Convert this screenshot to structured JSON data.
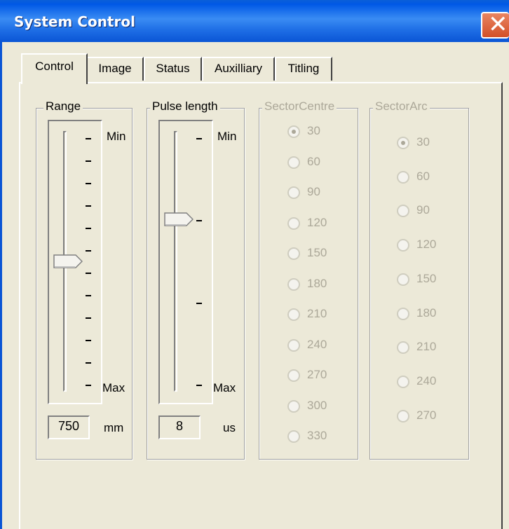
{
  "window": {
    "title": "System Control",
    "close_symbol": "✕"
  },
  "tabs": [
    {
      "label": "Control",
      "active": true
    },
    {
      "label": "Image"
    },
    {
      "label": "Status"
    },
    {
      "label": "Auxilliary"
    },
    {
      "label": "Titling"
    }
  ],
  "range": {
    "title": "Range",
    "min_label": "Min",
    "max_label": "Max",
    "value": "750",
    "unit": "mm",
    "tick_count": 12,
    "slider_level": 0.5
  },
  "pulse": {
    "title": "Pulse length",
    "min_label": "Min",
    "max_label": "Max",
    "value": "8",
    "unit": "us",
    "tick_count": 4,
    "slider_level": 0.33
  },
  "sector_centre": {
    "title": "SectorCentre",
    "options": [
      "30",
      "60",
      "90",
      "120",
      "150",
      "180",
      "210",
      "240",
      "270",
      "300",
      "330"
    ],
    "selected": "30"
  },
  "sector_arc": {
    "title": "SectorArc",
    "options": [
      "30",
      "60",
      "90",
      "120",
      "150",
      "180",
      "210",
      "240",
      "270"
    ],
    "selected": "30"
  }
}
